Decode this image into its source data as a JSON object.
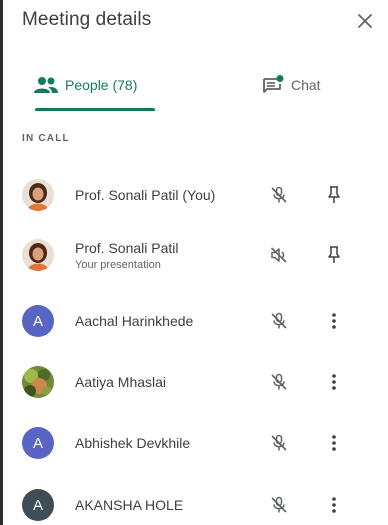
{
  "header": {
    "title": "Meeting details",
    "close_icon": "close-icon"
  },
  "tabs": [
    {
      "id": "people",
      "label": "People (78)",
      "icon": "people-icon",
      "active": true
    },
    {
      "id": "chat",
      "label": "Chat",
      "icon": "chat-icon",
      "active": false
    }
  ],
  "accent_color": "#137a60",
  "section": {
    "label": "IN CALL"
  },
  "participants": [
    {
      "name": "Prof. Sonali Patil (You)",
      "subtitle": "",
      "avatar": "photo",
      "mic_icon": "mic-off-icon",
      "action_icon": "pin-icon"
    },
    {
      "name": "Prof. Sonali Patil",
      "subtitle": "Your presentation",
      "avatar": "photo",
      "mic_icon": "volume-off-icon",
      "action_icon": "pin-icon"
    },
    {
      "name": "Aachal Harinkhede",
      "subtitle": "",
      "avatar": "A",
      "avatar_color": "#5865c4",
      "mic_icon": "mic-off-icon",
      "action_icon": "more-vert-icon"
    },
    {
      "name": "Aatiya Mhaslai",
      "subtitle": "",
      "avatar": "photo",
      "mic_icon": "mic-off-icon",
      "action_icon": "more-vert-icon"
    },
    {
      "name": "Abhishek Devkhile",
      "subtitle": "",
      "avatar": "A",
      "avatar_color": "#5865c4",
      "mic_icon": "mic-off-icon",
      "action_icon": "more-vert-icon"
    },
    {
      "name": "AKANSHA HOLE",
      "subtitle": "",
      "avatar": "A",
      "avatar_color": "#3f4e56",
      "mic_icon": "mic-off-icon",
      "action_icon": "more-vert-icon"
    }
  ]
}
